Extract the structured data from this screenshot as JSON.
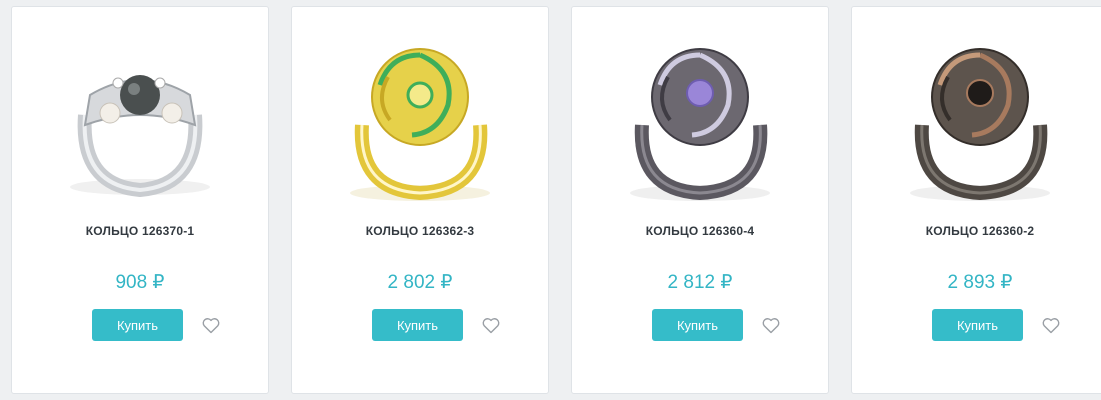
{
  "products": [
    {
      "title": "КОЛЬЦО 126370-1",
      "price": "908 ₽",
      "buy_label": "Купить",
      "image_icon": "silver-pearl-ring-image",
      "metal_color": "#c9ccd0",
      "stone_color": "#4a4f4f"
    },
    {
      "title": "КОЛЬЦО 126362-3",
      "price": "2 802 ₽",
      "buy_label": "Купить",
      "image_icon": "gold-green-stone-ring-image",
      "metal_color": "#e3c63a",
      "stone_color": "#3fae5a"
    },
    {
      "title": "КОЛЬЦО 126360-4",
      "price": "2 812 ₽",
      "buy_label": "Купить",
      "image_icon": "black-purple-stone-ring-image",
      "metal_color": "#5b5860",
      "stone_color": "#9a86d8"
    },
    {
      "title": "КОЛЬЦО 126360-2",
      "price": "2 893 ₽",
      "buy_label": "Купить",
      "image_icon": "black-brown-stone-ring-image",
      "metal_color": "#4e4843",
      "stone_color": "#a77a5e"
    }
  ],
  "colors": {
    "accent": "#35bcc9",
    "price": "#33b5c5",
    "page_background": "#eef0f2",
    "card_background": "#ffffff"
  }
}
